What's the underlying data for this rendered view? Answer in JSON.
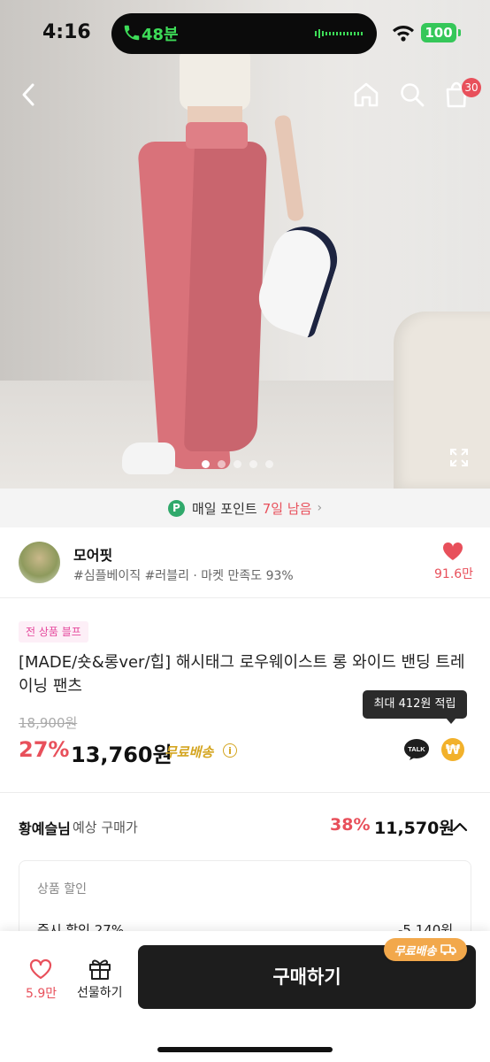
{
  "status_bar": {
    "time": "4:16",
    "call_duration": "48분",
    "battery": "100"
  },
  "header": {
    "cart_count": "30",
    "icons": [
      "back-icon",
      "home-icon",
      "search-icon",
      "cart-icon"
    ]
  },
  "gallery": {
    "slide_count": 5,
    "current_slide": 1
  },
  "points_banner": {
    "badge": "P",
    "label": "매일 포인트",
    "highlight": "7일 남음",
    "chevron": "›"
  },
  "store": {
    "name": "모어핏",
    "tags": "#심플베이직 #러블리 · 마켓 만족도 93%",
    "likes": "91.6만"
  },
  "product": {
    "promo_badge": "전 상품 블프",
    "title": "[MADE/숏&롱ver/힙] 해시태그 로우웨이스트 롱 와이드 밴딩 트레이닝 팬츠",
    "tooltip": "최대 412원 적립",
    "original_price": "18,900원",
    "discount": "27%",
    "price": "13,760원",
    "shipping": "무료배송",
    "info_mark": "i",
    "talk_label": "TALK",
    "won_label": "₩"
  },
  "expected_price": {
    "user": "황예슬님",
    "label": "예상 구매가",
    "discount": "38%",
    "price": "11,570원",
    "card_heading": "상품 할인",
    "row_label": "즉시 할인 27%",
    "row_value": "-5,140원"
  },
  "bottom_bar": {
    "wish_count": "5.9만",
    "gift_label": "선물하기",
    "buy_label": "구매하기",
    "free_shipping_badge": "무료배송"
  },
  "colors": {
    "accent_red": "#e8505b",
    "gold": "#d4a520",
    "buy_button": "#1d1d1d",
    "points_green": "#30a96b"
  }
}
